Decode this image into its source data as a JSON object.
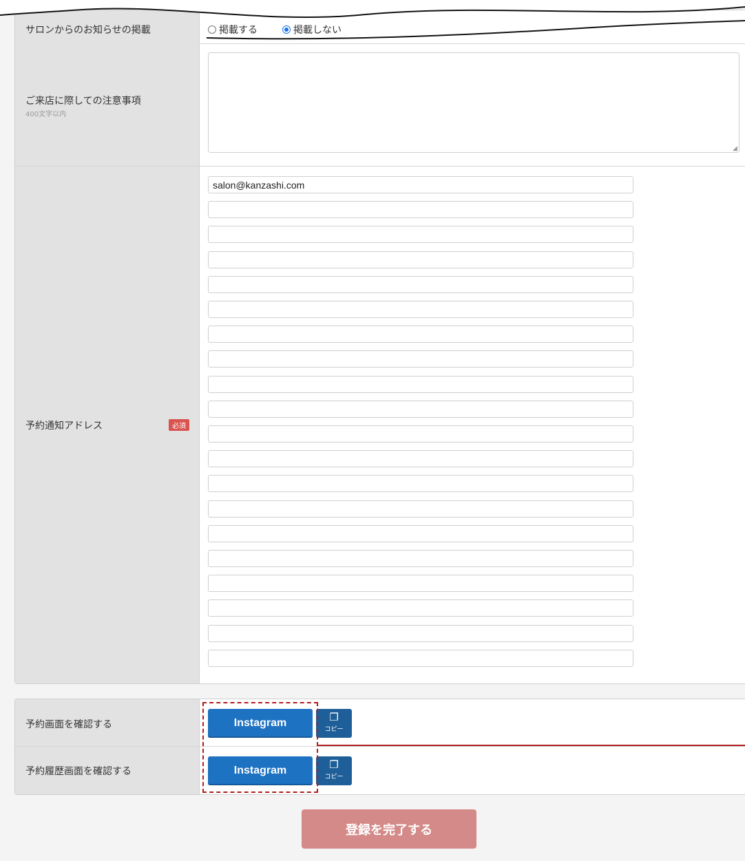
{
  "notice_row": {
    "label": "サロンからのお知らせの掲載",
    "options": [
      {
        "label": "掲載する",
        "selected": false
      },
      {
        "label": "掲載しない",
        "selected": true
      }
    ]
  },
  "notes_row": {
    "label": "ご来店に際しての注意事項",
    "sublabel": "400文字以内",
    "value": ""
  },
  "address_row": {
    "label": "予約通知アドレス",
    "badge": "必須",
    "fields": [
      "salon@kanzashi.com",
      "",
      "",
      "",
      "",
      "",
      "",
      "",
      "",
      "",
      "",
      "",
      "",
      "",
      "",
      "",
      "",
      "",
      "",
      ""
    ]
  },
  "confirm_rows": [
    {
      "label": "予約画面を確認する",
      "button": "Instagram",
      "copy": "コピー",
      "copy_icon": "copy-icon"
    },
    {
      "label": "予約履歴画面を確認する",
      "button": "Instagram",
      "copy": "コピー",
      "copy_icon": "copy-icon"
    }
  ],
  "submit": {
    "label": "登録を完了する"
  },
  "colors": {
    "primary": "#1d72c2",
    "copy": "#1f5f99",
    "submit": "#d48a88",
    "required": "#d9534f",
    "highlight": "#b01c1c"
  }
}
